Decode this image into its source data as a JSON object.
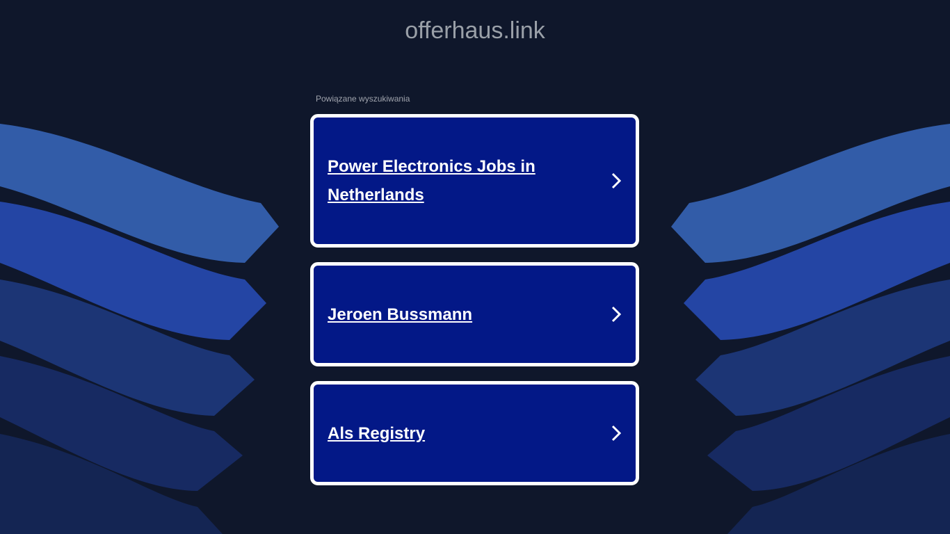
{
  "domain": "offerhaus.link",
  "related_label": "Powiązane wyszukiwania",
  "ads": [
    {
      "label": "Power Electronics Jobs in Netherlands"
    },
    {
      "label": "Jeroen Bussmann"
    },
    {
      "label": "Als Registry"
    }
  ],
  "colors": {
    "background": "#0f172b",
    "card": "#031887",
    "card_border": "#ffffff",
    "band_1": "#325ca8",
    "band_2": "#2445a4",
    "band_3": "#1c3575",
    "band_4": "#172a62",
    "band_5": "#142553"
  },
  "icons": {
    "ad_arrow": "chevron-right-icon"
  }
}
